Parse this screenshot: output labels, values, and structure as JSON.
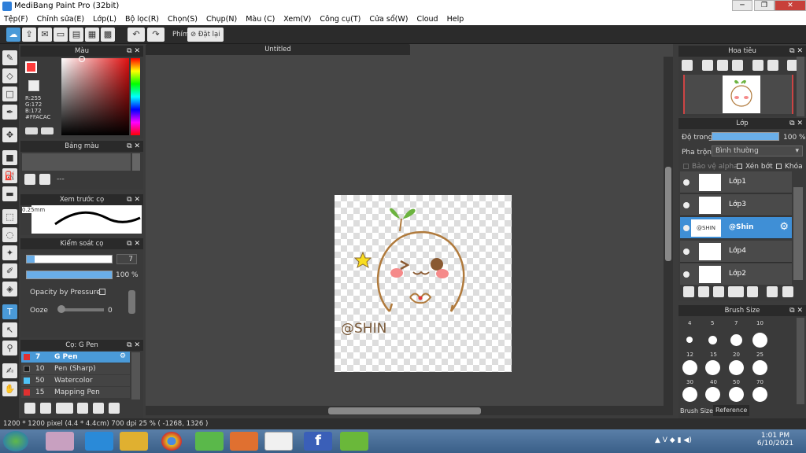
{
  "window": {
    "title": "MediBang Paint Pro (32bit)"
  },
  "menu": [
    "Tệp(F)",
    "Chỉnh sửa(E)",
    "Lớp(L)",
    "Bộ lọc(R)",
    "Chọn(S)",
    "Chụp(N)",
    "Màu (C)",
    "Xem(V)",
    "Công cụ(T)",
    "Cửa sổ(W)",
    "Cloud",
    "Help"
  ],
  "toolbar": {
    "phim_label": "Phím",
    "reset_label": "Đặt lại"
  },
  "color_panel": {
    "title": "Màu",
    "r": "R:255",
    "g": "G:172",
    "b": "B:172",
    "hex": "#FFACAC",
    "current_color": "#ff3b3b"
  },
  "palette_panel": {
    "title": "Bảng màu",
    "info": "---"
  },
  "brush_preview": {
    "title": "Xem trước cọ",
    "size": "0.25mm"
  },
  "brush_control": {
    "title": "Kiểm soát cọ",
    "size_value": "7",
    "opacity_value": "100 %",
    "opacity_pressure": "Opacity by Pressure",
    "ooze_label": "Ooze",
    "ooze_value": "0"
  },
  "brush_list": {
    "title": "Cọ: G Pen",
    "items": [
      {
        "num": "7",
        "name": "G Pen",
        "color": "#e03030"
      },
      {
        "num": "10",
        "name": "Pen (Sharp)",
        "color": "#1a1a1a"
      },
      {
        "num": "50",
        "name": "Watercolor",
        "color": "#4fc3f7"
      },
      {
        "num": "15",
        "name": "Mapping Pen",
        "color": "#e03030"
      }
    ]
  },
  "canvas": {
    "tab": "Untitled",
    "text": "@SHIN"
  },
  "navigator": {
    "title": "Hoa tiêu"
  },
  "layer_panel": {
    "title": "Lớp",
    "opacity_label": "Độ trong",
    "opacity_value": "100 %",
    "blend_label": "Pha trộn",
    "blend_value": "Bình thường",
    "protect_alpha": "Bảo vệ alpha",
    "clip": "Xén bớt",
    "lock": "Khóa",
    "layers": [
      {
        "name": "Lớp1",
        "selected": false
      },
      {
        "name": "Lớp3",
        "selected": false
      },
      {
        "name": "@Shin",
        "selected": true,
        "thumb": "@SHIN"
      },
      {
        "name": "Lớp4",
        "selected": false
      },
      {
        "name": "Lớp2",
        "selected": false
      }
    ]
  },
  "brush_size": {
    "title": "Brush Size",
    "labels": [
      "4",
      "5",
      "7",
      "10",
      "12",
      "15",
      "20",
      "25",
      "30",
      "40",
      "50",
      "70"
    ],
    "tab_size": "Brush Size",
    "tab_reference": "Reference"
  },
  "status": {
    "text": "1200 * 1200 pixel   (4.4 * 4.4cm)   700 dpi   25 %   ( -1268, 1326 )"
  },
  "taskbar": {
    "time": "1:01 PM",
    "date": "6/10/2021"
  }
}
